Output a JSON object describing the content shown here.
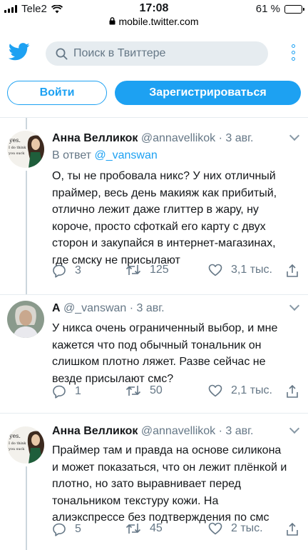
{
  "status": {
    "carrier": "Tele2",
    "time": "17:08",
    "battery": "61 %",
    "battery_level": 0.61
  },
  "browser": {
    "url": "mobile.twitter.com"
  },
  "header": {
    "search_placeholder": "Поиск в Твиттере"
  },
  "auth": {
    "login_label": "Войти",
    "signup_label": "Зарегистрироваться"
  },
  "colors": {
    "accent": "#1da1f2",
    "muted": "#657786",
    "text": "#14171a"
  },
  "tweets": [
    {
      "name": "Анна Велликок",
      "handle": "@annavellikok",
      "date": "· 3 авг.",
      "reply_prefix": "В ответ",
      "reply_mention": "@_vanswan",
      "lines": [
        "О, ты не пробовала никс? У них отличный",
        "праймер, весь день макияж как прибитый,",
        "отлично лежит даже глиттер в жару, ну",
        "короче, просто сфоткай его карту с двух",
        "сторон и закупайся в интернет-магазинах,",
        "где смску не присылают"
      ],
      "replies": "3",
      "retweets": "125",
      "likes": "3,1 тыс."
    },
    {
      "name": "А",
      "handle": "@_vanswan",
      "date": "· 3 авг.",
      "lines": [
        "У никса очень ограниченный выбор, и мне",
        "кажется что под обычный тональник он",
        "слишком плотно ляжет. Разве сейчас не",
        "везде присылают смс?"
      ],
      "replies": "1",
      "retweets": "50",
      "likes": "2,1 тыс."
    },
    {
      "name": "Анна Велликок",
      "handle": "@annavellikok",
      "date": "· 3 авг.",
      "lines": [
        "Праймер там и правда на основе силикона",
        "и может показаться, что он лежит плёнкой и",
        "плотно, но зато выравнивает перед",
        "тональником текстуру кожи. На",
        "алиэкспрессе без подтверждения по смс"
      ],
      "replies": "5",
      "retweets": "45",
      "likes": "2 тыс."
    }
  ],
  "avatar_badge": {
    "line1": "yes.",
    "line2": "I do think",
    "line3": "you suck"
  }
}
